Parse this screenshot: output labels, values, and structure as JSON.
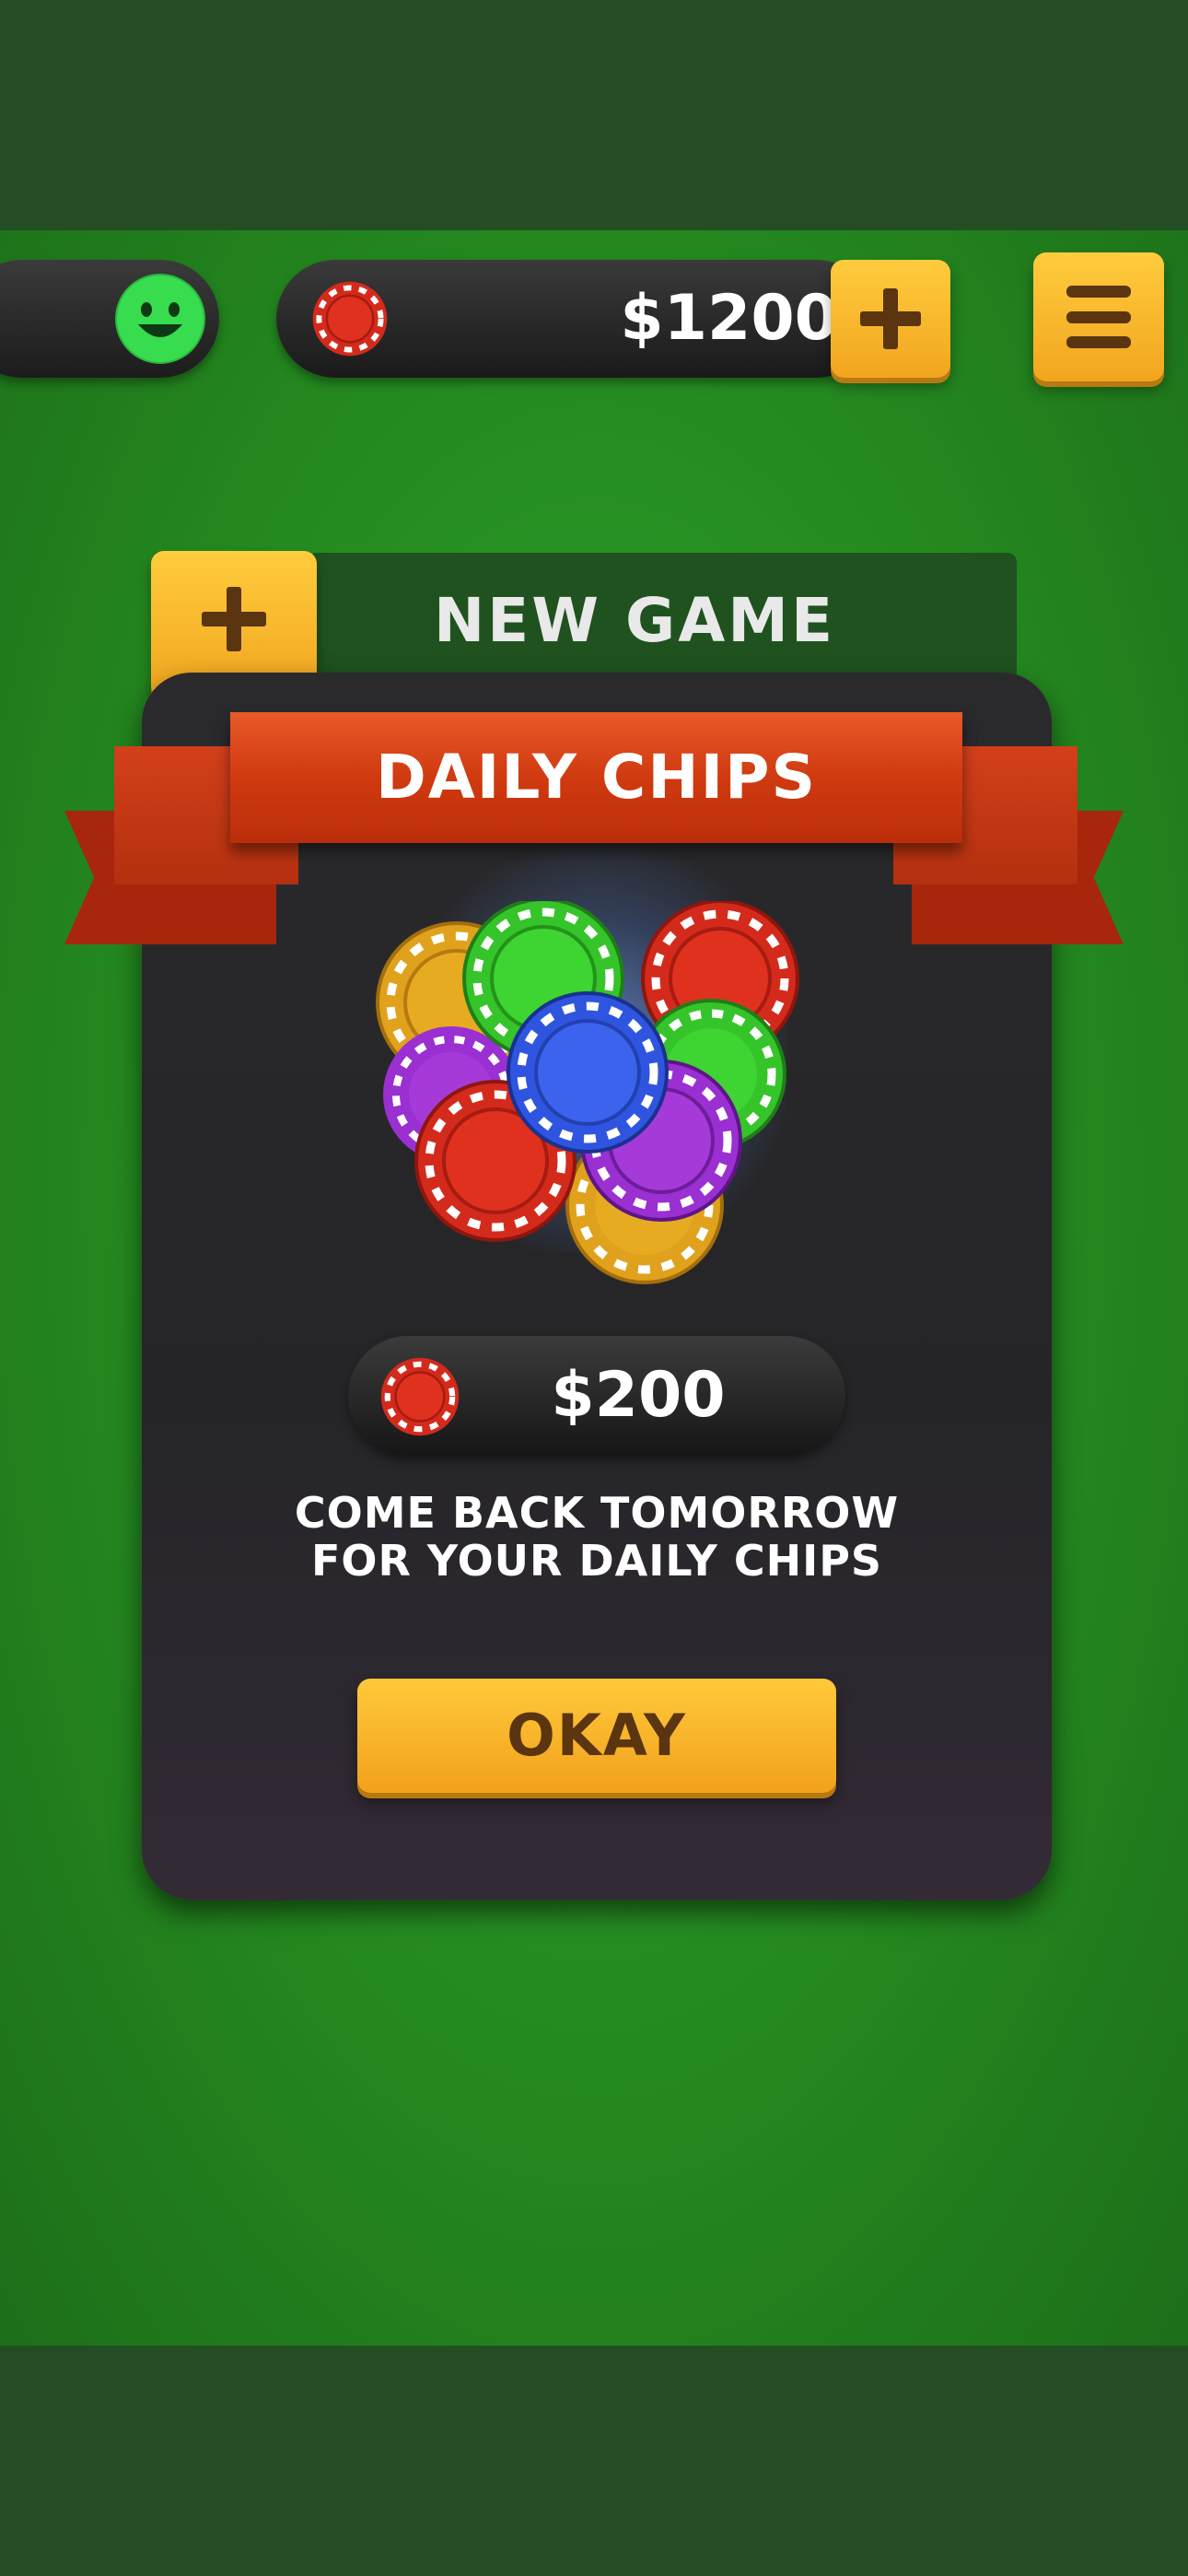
{
  "topbar": {
    "avatar_icon": "smiley-face-icon",
    "chip_icon": "red-poker-chip-icon",
    "balance": "$1200",
    "add_icon": "plus-icon",
    "menu_icon": "hamburger-menu-icon"
  },
  "new_game": {
    "label": "NEW GAME",
    "icon": "plus-icon"
  },
  "dialog": {
    "title": "DAILY CHIPS",
    "illustration": "poker-chips-pile",
    "reward_chip_icon": "red-poker-chip-icon",
    "reward_amount": "$200",
    "message_line1": "COME BACK TOMORROW",
    "message_line2": "FOR YOUR DAILY CHIPS",
    "ok_label": "OKAY"
  },
  "colors": {
    "felt": "#24891f",
    "letterbox": "#244d24",
    "button_yellow": "#f7b52a",
    "button_text": "#5a3510",
    "ribbon": "#d03a10",
    "dialog_bg": "#2a2a2d",
    "avatar_green": "#37dd4e"
  }
}
